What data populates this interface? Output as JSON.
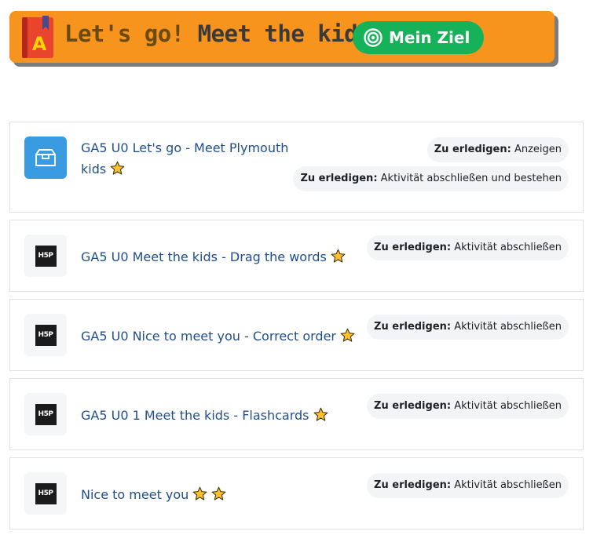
{
  "banner": {
    "title_part1": "Let's go!",
    "title_part2": "Meet the kids",
    "goal_button": "Mein Ziel",
    "color": "#f7941d",
    "goal_color": "#16b25a"
  },
  "completion_prefix": "Zu erledigen:",
  "activities": [
    {
      "name": "GA5 U0 Let's go - Meet Plymouth",
      "name_line2": "kids",
      "icon": "box-icon",
      "stars": 1,
      "requirements": [
        "Anzeigen",
        "Aktivität abschließen und bestehen"
      ]
    },
    {
      "name": "GA5 U0 Meet the kids - Drag the words",
      "icon": "h5p-icon",
      "stars": 1,
      "requirements": [
        "Aktivität abschließen"
      ]
    },
    {
      "name": "GA5 U0 Nice to meet you - Correct order",
      "icon": "h5p-icon",
      "stars": 1,
      "requirements": [
        "Aktivität abschließen"
      ]
    },
    {
      "name": "GA5 U0 1 Meet the kids - Flashcards",
      "icon": "h5p-icon",
      "stars": 1,
      "requirements": [
        "Aktivität abschließen"
      ]
    },
    {
      "name": "Nice to meet you",
      "icon": "h5p-icon",
      "stars": 2,
      "requirements": [
        "Aktivität abschließen"
      ]
    }
  ],
  "h5p_label": "H5P"
}
